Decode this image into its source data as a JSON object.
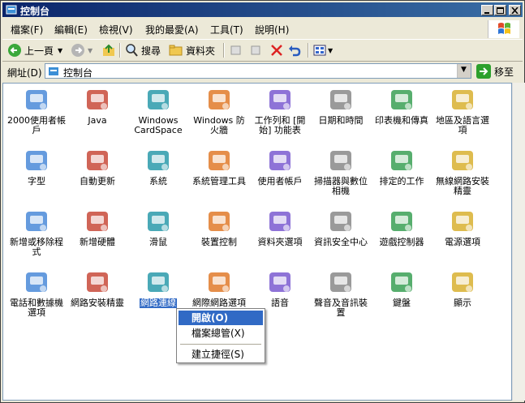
{
  "window": {
    "title": "控制台"
  },
  "menu": [
    "檔案(F)",
    "編輯(E)",
    "檢視(V)",
    "我的最愛(A)",
    "工具(T)",
    "說明(H)"
  ],
  "toolbar": {
    "back": "上一頁",
    "search": "搜尋",
    "folders": "資料夾"
  },
  "address": {
    "label": "網址(D)",
    "value": "控制台",
    "go": "移至"
  },
  "items": [
    {
      "label": "2000使用者帳戶",
      "icon": "users-icon"
    },
    {
      "label": "Java",
      "icon": "java-icon"
    },
    {
      "label": "Windows CardSpace",
      "icon": "cardspace-icon"
    },
    {
      "label": "Windows 防火牆",
      "icon": "firewall-icon"
    },
    {
      "label": "工作列和 [開始] 功能表",
      "icon": "taskbar-icon"
    },
    {
      "label": "日期和時間",
      "icon": "clock-icon"
    },
    {
      "label": "印表機和傳真",
      "icon": "printer-icon"
    },
    {
      "label": "地區及語言選項",
      "icon": "globe-icon"
    },
    {
      "label": "字型",
      "icon": "fonts-icon"
    },
    {
      "label": "自動更新",
      "icon": "update-icon"
    },
    {
      "label": "系統",
      "icon": "system-icon"
    },
    {
      "label": "系統管理工具",
      "icon": "admin-tools-icon"
    },
    {
      "label": "使用者帳戶",
      "icon": "user-accounts-icon"
    },
    {
      "label": "掃描器與數位相機",
      "icon": "scanner-icon"
    },
    {
      "label": "排定的工作",
      "icon": "scheduled-tasks-icon"
    },
    {
      "label": "無線網路安裝精靈",
      "icon": "wireless-icon"
    },
    {
      "label": "新增或移除程式",
      "icon": "add-remove-icon"
    },
    {
      "label": "新增硬體",
      "icon": "hardware-icon"
    },
    {
      "label": "滑鼠",
      "icon": "mouse-icon"
    },
    {
      "label": "裝置控制",
      "icon": "device-icon"
    },
    {
      "label": "資料夾選項",
      "icon": "folder-options-icon"
    },
    {
      "label": "資訊安全中心",
      "icon": "security-icon"
    },
    {
      "label": "遊戲控制器",
      "icon": "gamepad-icon"
    },
    {
      "label": "電源選項",
      "icon": "power-icon"
    },
    {
      "label": "電話和數據機選項",
      "icon": "phone-icon"
    },
    {
      "label": "網路安裝精靈",
      "icon": "network-wizard-icon"
    },
    {
      "label": "網路連線",
      "icon": "network-icon"
    },
    {
      "label": "網際網路選項",
      "icon": "internet-icon"
    },
    {
      "label": "語音",
      "icon": "speech-icon"
    },
    {
      "label": "聲音及音訊裝置",
      "icon": "sound-icon"
    },
    {
      "label": "鍵盤",
      "icon": "keyboard-icon"
    },
    {
      "label": "顯示",
      "icon": "display-icon"
    }
  ],
  "context_menu": [
    "開啟(O)",
    "檔案總管(X)",
    "建立捷徑(S)"
  ]
}
